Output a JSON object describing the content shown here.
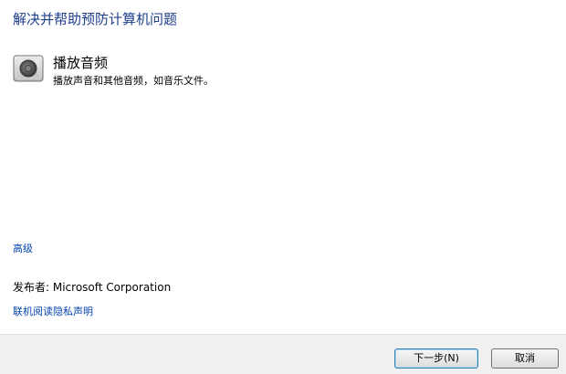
{
  "header": {
    "title": "解决并帮助预防计算机问题"
  },
  "troubleshooter": {
    "icon": "audio-speaker-icon",
    "name": "播放音频",
    "description": "播放声音和其他音频，如音乐文件。"
  },
  "links": {
    "advanced": "高级",
    "privacy": "联机阅读隐私声明"
  },
  "publisher": {
    "text": "发布者:  Microsoft Corporation"
  },
  "footer": {
    "next_label": "下一步(N)",
    "cancel_label": "取消"
  },
  "colors": {
    "title": "#1e3e8a",
    "link": "#0645ad",
    "footer_bg": "#f0f0f0"
  }
}
